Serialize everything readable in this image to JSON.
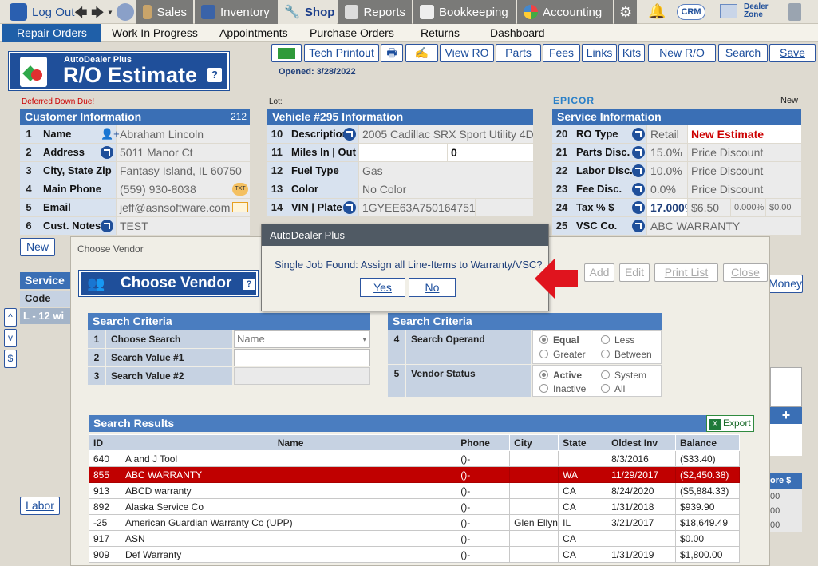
{
  "nav": {
    "logout": "Log Out",
    "items": [
      "Sales",
      "Inventory",
      "Shop",
      "Reports",
      "Bookkeeping",
      "Accounting"
    ],
    "crm": "CRM",
    "dealer_zone": "Dealer Zone"
  },
  "subnav": [
    "Repair Orders",
    "Work In Progress",
    "Appointments",
    "Purchase Orders",
    "Returns",
    "Dashboard"
  ],
  "logo": {
    "small": "AutoDealer Plus",
    "big": "R/O Estimate",
    "help": "?"
  },
  "toolbar": [
    "Tech Printout",
    "View RO",
    "Parts",
    "Fees",
    "Links",
    "Kits",
    "New R/O",
    "Search",
    "Save"
  ],
  "opened": "Opened: 3/28/2022",
  "deferred": "Deferred Down Due!",
  "lot": "Lot:",
  "epicor": "EPICOR",
  "new_label": "New",
  "customer": {
    "title": "Customer Information",
    "count": "212",
    "rows": [
      {
        "n": "1",
        "l": "Name",
        "v": "Abraham Lincoln"
      },
      {
        "n": "2",
        "l": "Address",
        "v": "5011 Manor Ct"
      },
      {
        "n": "3",
        "l": "City, State Zip",
        "v": "Fantasy Island, IL 60750"
      },
      {
        "n": "4",
        "l": "Main Phone",
        "v": "(559) 930-8038"
      },
      {
        "n": "5",
        "l": "Email",
        "v": "jeff@asnsoftware.com"
      },
      {
        "n": "6",
        "l": "Cust. Notes",
        "v": "TEST"
      }
    ],
    "txt_icon": "TXT"
  },
  "vehicle": {
    "title": "Vehicle #295 Information",
    "rows": [
      {
        "n": "10",
        "l": "Description",
        "v": "2005 Cadillac SRX Sport Utility 4D"
      },
      {
        "n": "11",
        "l": "Miles  In | Out",
        "v": "",
        "v2": "0"
      },
      {
        "n": "12",
        "l": "Fuel Type",
        "v": "Gas"
      },
      {
        "n": "13",
        "l": "Color",
        "v": "No Color"
      },
      {
        "n": "14",
        "l": "VIN | Plate",
        "v": "1GYEE63A750164751"
      }
    ]
  },
  "service": {
    "title": "Service Information",
    "rows": [
      {
        "n": "20",
        "l": "RO Type",
        "v": "Retail",
        "v2": "New Estimate"
      },
      {
        "n": "21",
        "l": "Parts Disc.",
        "v": "15.0%",
        "v2": "Price Discount"
      },
      {
        "n": "22",
        "l": "Labor Disc.",
        "v": "10.0%",
        "v2": "Price Discount"
      },
      {
        "n": "23",
        "l": "Fee Disc.",
        "v": "0.0%",
        "v2": "Price Discount"
      },
      {
        "n": "24",
        "l": "Tax % $",
        "v": "17.000%",
        "v3": "$6.50",
        "v4": "0.000%",
        "v5": "$0.00"
      },
      {
        "n": "25",
        "l": "VSC Co.",
        "v": "ABC WARRANTY"
      }
    ]
  },
  "left_btns": {
    "new": "New",
    "s": "S",
    "service": "Service P",
    "code": "Code",
    "row": "L - 12  wi",
    "up": "^",
    "down": "v",
    "dollar": "$",
    "labor": "Labor"
  },
  "right_partial": {
    "money": "Money",
    "plus": "+",
    "more": "ore $",
    "z1": "00",
    "z2": "00",
    "z3": "00"
  },
  "vendor": {
    "window_title": "Choose Vendor",
    "title": "Choose Vendor",
    "help": "?",
    "buttons": [
      "Add",
      "Edit",
      "Print List",
      "Close"
    ],
    "criteria1": {
      "title": "Search Criteria",
      "rows": [
        {
          "n": "1",
          "l": "Choose Search",
          "v": "Name"
        },
        {
          "n": "2",
          "l": "Search Value #1",
          "v": ""
        },
        {
          "n": "3",
          "l": "Search Value #2",
          "v": ""
        }
      ]
    },
    "criteria2": {
      "title": "Search Criteria",
      "operand": {
        "n": "4",
        "l": "Search Operand",
        "opts": [
          "Equal",
          "Less",
          "Greater",
          "Between"
        ]
      },
      "status": {
        "n": "5",
        "l": "Vendor Status",
        "opts": [
          "Active",
          "System",
          "Inactive",
          "All"
        ]
      }
    },
    "results_title": "Search Results",
    "export": "Export",
    "columns": [
      "ID",
      "Name",
      "Phone",
      "City",
      "State",
      "Oldest Inv",
      "Balance"
    ],
    "rows": [
      [
        "640",
        "A and J Tool",
        "()-",
        "",
        "",
        "8/3/2016",
        "($33.40)"
      ],
      [
        "855",
        "ABC WARRANTY",
        "()-",
        "",
        "WA",
        "11/29/2017",
        "($2,450.38)"
      ],
      [
        "913",
        "ABCD warranty",
        "()-",
        "",
        "CA",
        "8/24/2020",
        "($5,884.33)"
      ],
      [
        "892",
        "Alaska Service Co",
        "()-",
        "",
        "CA",
        "1/31/2018",
        "$939.90"
      ],
      [
        "-25",
        "American Guardian Warranty Co (UPP)",
        "()-",
        "Glen Ellyn",
        "IL",
        "3/21/2017",
        "$18,649.49"
      ],
      [
        "917",
        "ASN",
        "()-",
        "",
        "CA",
        "",
        "$0.00"
      ],
      [
        "909",
        "Def Warranty",
        "()-",
        "",
        "CA",
        "1/31/2019",
        "$1,800.00"
      ]
    ]
  },
  "alert": {
    "title": "AutoDealer Plus",
    "message": "Single Job Found:  Assign all Line-Items to Warranty/VSC?",
    "yes": "Yes",
    "no": "No"
  },
  "colors": {
    "accent": "#3a6fb5",
    "selected_row": "#c00000",
    "arrow": "#e0141e"
  }
}
